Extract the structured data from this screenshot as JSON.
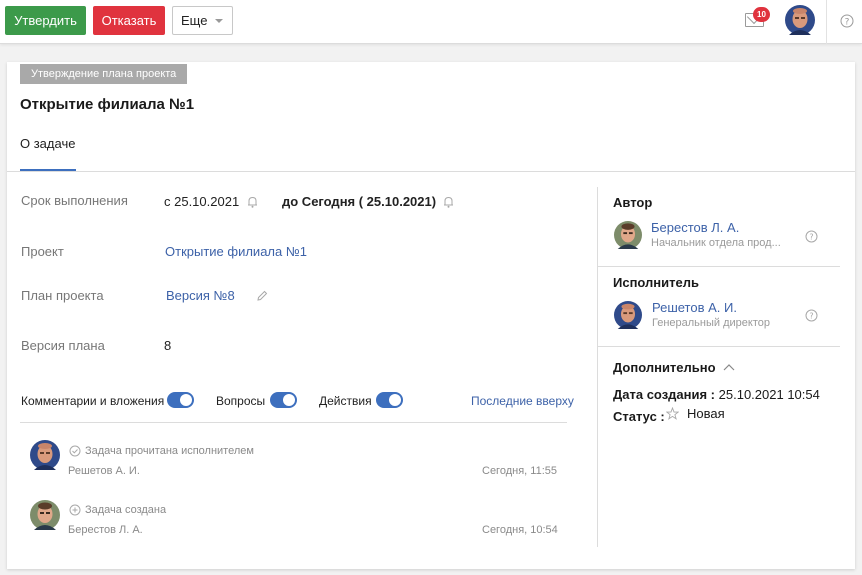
{
  "toolbar": {
    "approve_label": "Утвердить",
    "reject_label": "Отказать",
    "more_label": "Еще",
    "notifications_count": "10"
  },
  "task": {
    "category": "Утверждение плана проекта",
    "title": "Открытие филиала №1",
    "tab_label": "О задаче"
  },
  "fields": {
    "deadline_label": "Срок выполнения",
    "deadline_from": "с 25.10.2021",
    "deadline_to": "до Сегодня ( 25.10.2021)",
    "project_label": "Проект",
    "project_value": "Открытие филиала №1",
    "plan_label": "План проекта",
    "plan_value": "Версия №8",
    "plan_version_label": "Версия плана",
    "plan_version_value": "8"
  },
  "filters": {
    "comments_label": "Комментарии и вложения",
    "questions_label": "Вопросы",
    "actions_label": "Действия",
    "sort_label": "Последние вверху"
  },
  "activity": [
    {
      "text": "Задача прочитана исполнителем",
      "author": "Решетов А. И.",
      "time": "Сегодня, 11:55"
    },
    {
      "text": "Задача создана",
      "author": "Берестов Л. А.",
      "time": "Сегодня, 10:54"
    }
  ],
  "sidebar": {
    "author_title": "Автор",
    "author_name": "Берестов Л. А.",
    "author_role": "Начальник отдела прод...",
    "assignee_title": "Исполнитель",
    "assignee_name": "Решетов А. И.",
    "assignee_role": "Генеральный директор",
    "extra_title": "Дополнительно",
    "created_label": "Дата создания :",
    "created_value": "25.10.2021 10:54",
    "status_label": "Статус :",
    "status_value": "Новая"
  },
  "colors": {
    "approve": "#3c9a4a",
    "reject": "#e0333e",
    "accent": "#3d6fbe",
    "link": "#3d62a8"
  }
}
